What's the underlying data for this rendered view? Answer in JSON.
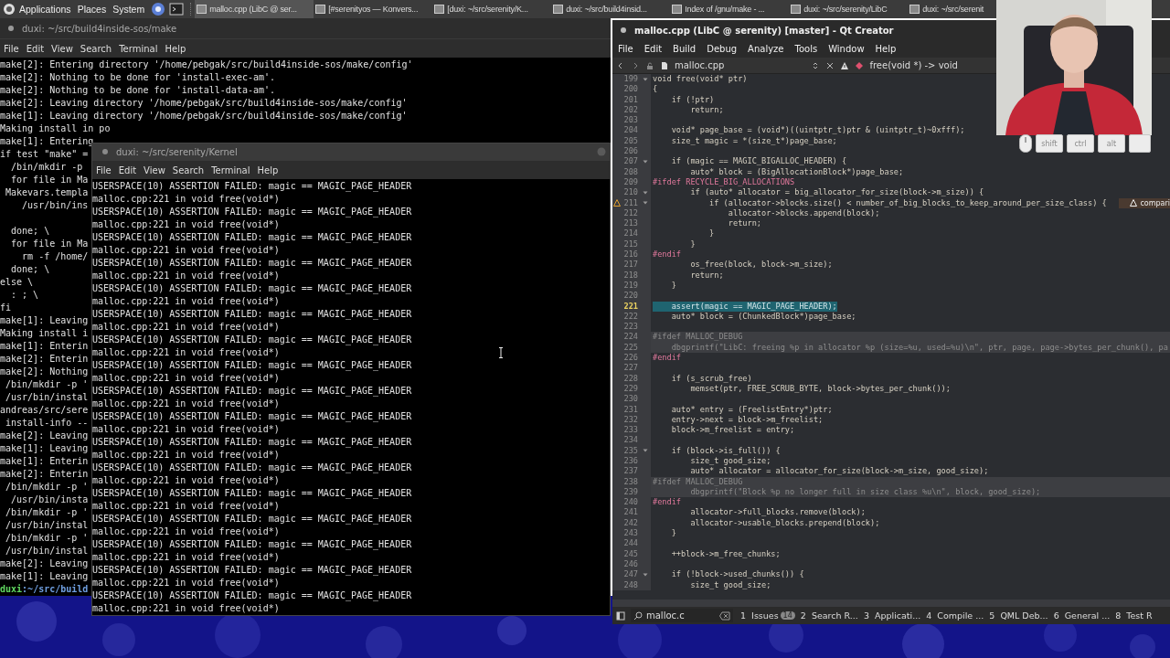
{
  "panel": {
    "menus": [
      "Applications",
      "Places",
      "System"
    ],
    "tasks": [
      {
        "title": "malloc.cpp (LibC @ ser...",
        "selected": true
      },
      {
        "title": "[#serenityos — Konvers...",
        "selected": false
      },
      {
        "title": "[duxi: ~/src/serenity/K...",
        "selected": false
      },
      {
        "title": "duxi: ~/src/build4insid...",
        "selected": false
      },
      {
        "title": "Index of /gnu/make - ...",
        "selected": false
      },
      {
        "title": "duxi: ~/src/serenity/LibC",
        "selected": false
      },
      {
        "title": "duxi: ~/src/serenit",
        "selected": false
      }
    ]
  },
  "back_terminal": {
    "title": "duxi: ~/src/build4inside-sos/make",
    "menu": [
      "File",
      "Edit",
      "View",
      "Search",
      "Terminal",
      "Help"
    ],
    "blocks": [
      [
        "make[2]: Entering directory '/home/pebgak/src/build4inside-sos/make/config'",
        "make[2]: Nothing to be done for 'install-exec-am'.",
        "make[2]: Nothing to be done for 'install-data-am'.",
        "make[2]: Leaving directory '/home/pebgak/src/build4inside-sos/make/config'",
        "make[1]: Leaving directory '/home/pebgak/src/build4inside-sos/make/config'",
        "Making install in po",
        "make[1]: Entering",
        "if test \"make\" =",
        "  /bin/mkdir -p",
        "  for file in Ma",
        " Makevars.templa",
        "    /usr/bin/ins"
      ],
      [
        "  done; \\",
        "  for file in Ma",
        "    rm -f /home/",
        "  done; \\",
        "else \\",
        "  : ; \\",
        "fi",
        "make[1]: Leaving",
        "Making install i",
        "make[1]: Enterin",
        "make[2]: Enterin",
        "make[2]: Nothing",
        " /bin/mkdir -p '",
        " /usr/bin/instal",
        "andreas/src/sere",
        " install-info --",
        "make[2]: Leaving",
        "make[1]: Leaving",
        "make[1]: Enterin",
        "make[2]: Enterin",
        " /bin/mkdir -p '",
        "  /usr/bin/insta",
        " /bin/mkdir -p '",
        " /usr/bin/instal",
        " /bin/mkdir -p '",
        " /usr/bin/instal",
        "make[2]: Leaving",
        "make[1]: Leaving"
      ]
    ],
    "prompt": {
      "user": "duxi",
      "path": ":~/src/build"
    }
  },
  "front_terminal": {
    "title": "duxi: ~/src/serenity/Kernel",
    "menu": [
      "File",
      "Edit",
      "View",
      "Search",
      "Terminal",
      "Help"
    ],
    "lines": [
      "USERSPACE(10) ASSERTION FAILED: magic == MAGIC_PAGE_HEADER",
      "malloc.cpp:221 in void free(void*)",
      "USERSPACE(10) ASSERTION FAILED: magic == MAGIC_PAGE_HEADER",
      "malloc.cpp:221 in void free(void*)",
      "USERSPACE(10) ASSERTION FAILED: magic == MAGIC_PAGE_HEADER",
      "malloc.cpp:221 in void free(void*)",
      "USERSPACE(10) ASSERTION FAILED: magic == MAGIC_PAGE_HEADER",
      "malloc.cpp:221 in void free(void*)",
      "USERSPACE(10) ASSERTION FAILED: magic == MAGIC_PAGE_HEADER",
      "malloc.cpp:221 in void free(void*)",
      "USERSPACE(10) ASSERTION FAILED: magic == MAGIC_PAGE_HEADER",
      "malloc.cpp:221 in void free(void*)",
      "USERSPACE(10) ASSERTION FAILED: magic == MAGIC_PAGE_HEADER",
      "malloc.cpp:221 in void free(void*)",
      "USERSPACE(10) ASSERTION FAILED: magic == MAGIC_PAGE_HEADER",
      "malloc.cpp:221 in void free(void*)",
      "USERSPACE(10) ASSERTION FAILED: magic == MAGIC_PAGE_HEADER",
      "malloc.cpp:221 in void free(void*)",
      "USERSPACE(10) ASSERTION FAILED: magic == MAGIC_PAGE_HEADER",
      "malloc.cpp:221 in void free(void*)",
      "USERSPACE(10) ASSERTION FAILED: magic == MAGIC_PAGE_HEADER",
      "malloc.cpp:221 in void free(void*)",
      "USERSPACE(10) ASSERTION FAILED: magic == MAGIC_PAGE_HEADER",
      "malloc.cpp:221 in void free(void*)",
      "USERSPACE(10) ASSERTION FAILED: magic == MAGIC_PAGE_HEADER",
      "malloc.cpp:221 in void free(void*)",
      "USERSPACE(10) ASSERTION FAILED: magic == MAGIC_PAGE_HEADER",
      "malloc.cpp:221 in void free(void*)",
      "USERSPACE(10) ASSERTION FAILED: magic == MAGIC_PAGE_HEADER",
      "malloc.cpp:221 in void free(void*)",
      "USERSPACE(10) ASSERTION FAILED: magic == MAGIC_PAGE_HEADER",
      "malloc.cpp:221 in void free(void*)",
      "USERSPACE(10) ASSERTION FAILED: magic == MAGIC_PAGE_HEADER",
      "malloc.cpp:221 in void free(void*)"
    ]
  },
  "editor": {
    "title": "malloc.cpp (LibC @ serenity) [master] - Qt Creator",
    "menu": [
      "File",
      "Edit",
      "Build",
      "Debug",
      "Analyze",
      "Tools",
      "Window",
      "Help"
    ],
    "toolbar": {
      "file": "malloc.cpp",
      "symbol": "free(void *) -> void"
    },
    "code": [
      {
        "num": "199",
        "text": "void free(void* ptr)",
        "kind": "code",
        "fold": true
      },
      {
        "num": "200",
        "text": "{",
        "kind": "code",
        "fold": false
      },
      {
        "num": "201",
        "text": "    if (!ptr)",
        "kind": "code",
        "fold": false
      },
      {
        "num": "202",
        "text": "        return;",
        "kind": "code",
        "fold": false
      },
      {
        "num": "203",
        "kind": "code",
        "fold": false
      },
      {
        "num": "204",
        "text": "    void* page_base = (void*)((uintptr_t)ptr & (uintptr_t)~0xfff);",
        "kind": "code",
        "fold": false
      },
      {
        "num": "205",
        "text": "    size_t magic = *(size_t*)page_base;",
        "kind": "code",
        "fold": false
      },
      {
        "num": "206",
        "kind": "code",
        "fold": false
      },
      {
        "num": "207",
        "text": "    if (magic == MAGIC_BIGALLOC_HEADER) {",
        "kind": "code",
        "fold": true
      },
      {
        "num": "208",
        "text": "        auto* block = (BigAllocationBlock*)page_base;",
        "kind": "code",
        "fold": false
      },
      {
        "num": "209",
        "text": "#ifdef RECYCLE_BIG_ALLOCATIONS",
        "kind": "preproc",
        "fold": false
      },
      {
        "num": "210",
        "text": "        if (auto* allocator = big_allocator_for_size(block->m_size)) {",
        "kind": "code",
        "fold": true
      },
      {
        "num": "211",
        "text": "            if (allocator->blocks.size() < number_of_big_blocks_to_keep_around_per_size_class) {",
        "kind": "code",
        "fold": true,
        "warning": "compari"
      },
      {
        "num": "212",
        "text": "                allocator->blocks.append(block);",
        "kind": "code",
        "fold": false
      },
      {
        "num": "213",
        "text": "                return;",
        "kind": "code",
        "fold": false
      },
      {
        "num": "214",
        "text": "            }",
        "kind": "code",
        "fold": false
      },
      {
        "num": "215",
        "text": "        }",
        "kind": "code",
        "fold": false
      },
      {
        "num": "216",
        "text": "#endif",
        "kind": "preproc",
        "fold": false
      },
      {
        "num": "217",
        "text": "        os_free(block, block->m_size);",
        "kind": "code",
        "fold": false
      },
      {
        "num": "218",
        "text": "        return;",
        "kind": "code",
        "fold": false
      },
      {
        "num": "219",
        "text": "    }",
        "kind": "code",
        "fold": false
      },
      {
        "num": "220",
        "kind": "code",
        "fold": false
      },
      {
        "num": "221",
        "text": "    assert(magic == MAGIC_PAGE_HEADER);",
        "kind": "current",
        "fold": false
      },
      {
        "num": "222",
        "text": "    auto* block = (ChunkedBlock*)page_base;",
        "kind": "code",
        "fold": false
      },
      {
        "num": "223",
        "kind": "code",
        "fold": false
      },
      {
        "num": "224",
        "text": "#ifdef MALLOC_DEBUG",
        "kind": "disabled",
        "fold": false
      },
      {
        "num": "225",
        "text": "    dbgprintf(\"LibC: freeing %p in allocator %p (size=%u, used=%u)\\n\", ptr, page, page->bytes_per_chunk(), pa",
        "kind": "disabled",
        "fold": false
      },
      {
        "num": "226",
        "text": "#endif",
        "kind": "preproc",
        "fold": false
      },
      {
        "num": "227",
        "kind": "code",
        "fold": false
      },
      {
        "num": "228",
        "text": "    if (s_scrub_free)",
        "kind": "code",
        "fold": false
      },
      {
        "num": "229",
        "text": "        memset(ptr, FREE_SCRUB_BYTE, block->bytes_per_chunk());",
        "kind": "code",
        "fold": false
      },
      {
        "num": "230",
        "kind": "code",
        "fold": false
      },
      {
        "num": "231",
        "text": "    auto* entry = (FreelistEntry*)ptr;",
        "kind": "code",
        "fold": false
      },
      {
        "num": "232",
        "text": "    entry->next = block->m_freelist;",
        "kind": "code",
        "fold": false
      },
      {
        "num": "233",
        "text": "    block->m_freelist = entry;",
        "kind": "code",
        "fold": false
      },
      {
        "num": "234",
        "kind": "code",
        "fold": false
      },
      {
        "num": "235",
        "text": "    if (block->is_full()) {",
        "kind": "code",
        "fold": true
      },
      {
        "num": "236",
        "text": "        size_t good_size;",
        "kind": "code",
        "fold": false
      },
      {
        "num": "237",
        "text": "        auto* allocator = allocator_for_size(block->m_size, good_size);",
        "kind": "code",
        "fold": false
      },
      {
        "num": "238",
        "text": "#ifdef MALLOC_DEBUG",
        "kind": "disabled",
        "fold": false
      },
      {
        "num": "239",
        "text": "        dbgprintf(\"Block %p no longer full in size class %u\\n\", block, good_size);",
        "kind": "disabled",
        "fold": false
      },
      {
        "num": "240",
        "text": "#endif",
        "kind": "preproc",
        "fold": false
      },
      {
        "num": "241",
        "text": "        allocator->full_blocks.remove(block);",
        "kind": "code",
        "fold": false
      },
      {
        "num": "242",
        "text": "        allocator->usable_blocks.prepend(block);",
        "kind": "code",
        "fold": false
      },
      {
        "num": "243",
        "text": "    }",
        "kind": "code",
        "fold": false
      },
      {
        "num": "244",
        "kind": "code",
        "fold": false
      },
      {
        "num": "245",
        "text": "    ++block->m_free_chunks;",
        "kind": "code",
        "fold": false
      },
      {
        "num": "246",
        "kind": "code",
        "fold": false
      },
      {
        "num": "247",
        "text": "    if (!block->used_chunks()) {",
        "kind": "code",
        "fold": true
      },
      {
        "num": "248",
        "text": "        size_t good_size;",
        "kind": "code",
        "fold": false
      }
    ],
    "locator": {
      "value": "malloc.c"
    },
    "output_tabs": [
      {
        "num": "1",
        "label": "Issues",
        "badge": "14"
      },
      {
        "num": "2",
        "label": "Search R..."
      },
      {
        "num": "3",
        "label": "Applicati..."
      },
      {
        "num": "4",
        "label": "Compile ..."
      },
      {
        "num": "5",
        "label": "QML Deb..."
      },
      {
        "num": "6",
        "label": "General ..."
      },
      {
        "num": "8",
        "label": "Test R"
      }
    ]
  },
  "key_overlay": {
    "keys": [
      "shift",
      "ctrl",
      "alt"
    ]
  }
}
